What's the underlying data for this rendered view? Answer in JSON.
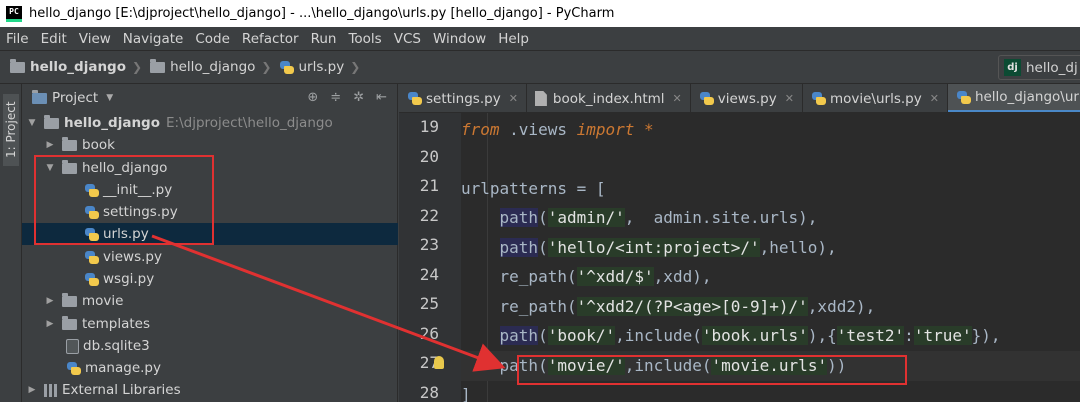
{
  "window": {
    "title": "hello_django [E:\\djproject\\hello_django] - ...\\hello_django\\urls.py [hello_django] - PyCharm"
  },
  "menu": [
    "File",
    "Edit",
    "View",
    "Navigate",
    "Code",
    "Refactor",
    "Run",
    "Tools",
    "VCS",
    "Window",
    "Help"
  ],
  "breadcrumb": {
    "root": "hello_django",
    "folder": "hello_django",
    "file": "urls.py"
  },
  "run_config": {
    "label": "hello_dj"
  },
  "stripe": {
    "label": "1: Project"
  },
  "project_panel": {
    "title": "Project",
    "tree": [
      {
        "label": "hello_django",
        "path": "E:\\djproject\\hello_django"
      },
      {
        "label": "book"
      },
      {
        "label": "hello_django"
      },
      {
        "label": "__init__.py"
      },
      {
        "label": "settings.py"
      },
      {
        "label": "urls.py"
      },
      {
        "label": "views.py"
      },
      {
        "label": "wsgi.py"
      },
      {
        "label": "movie"
      },
      {
        "label": "templates"
      },
      {
        "label": "db.sqlite3"
      },
      {
        "label": "manage.py"
      },
      {
        "label": "External Libraries"
      }
    ]
  },
  "tabs": [
    {
      "label": "settings.py"
    },
    {
      "label": "book_index.html"
    },
    {
      "label": "views.py"
    },
    {
      "label": "movie\\urls.py"
    },
    {
      "label": "hello_django\\urls.py"
    }
  ],
  "editor": {
    "line_numbers": [
      "19",
      "20",
      "21",
      "22",
      "23",
      "24",
      "25",
      "26",
      "27",
      "28"
    ],
    "code": {
      "l19": {
        "kw1": "from",
        "mid": " .views ",
        "kw2": "import",
        "star": " *"
      },
      "l21": "urlpatterns = [",
      "l22": {
        "fn": "path",
        "a": "(",
        "s": "'admin/'",
        "rest": ",  admin.site.urls),"
      },
      "l23": {
        "fn": "path",
        "a": "(",
        "s": "'hello/<int:project>/'",
        "rest": ",hello),"
      },
      "l24": {
        "fn": "re_path",
        "a": "(",
        "s": "'^xdd/$'",
        "rest": ",xdd),"
      },
      "l25": {
        "fn": "re_path",
        "a": "(",
        "s": "'^xdd2/(?P<age>[0-9]+)/'",
        "rest": ",xdd2),"
      },
      "l26": {
        "fn": "path",
        "a": "(",
        "s": "'book/'",
        "b": ",",
        "fn2": "include",
        "c": "(",
        "s2": "'book.urls'",
        "d": "),{",
        "s3": "'test2'",
        "e": ":",
        "s4": "'true'",
        "f": "}),"
      },
      "l27": {
        "fn": "path",
        "a": "(",
        "s": "'movie/'",
        "b": ",",
        "fn2": "include",
        "c": "(",
        "s2": "'movie.urls'",
        "d": "))"
      },
      "l28": "]"
    }
  },
  "colors": {
    "annotation": "#e03131",
    "selection": "#0d293e",
    "tab_underline": "#4a88c7"
  }
}
